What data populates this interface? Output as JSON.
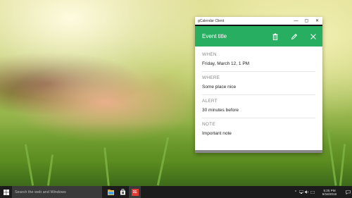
{
  "window": {
    "title": "gCalendar Client",
    "controls": {
      "minimize": "—",
      "maximize": "▢",
      "close": "✕"
    }
  },
  "header": {
    "event_title": "Event title",
    "accent_color": "#27ae60",
    "actions": [
      "trash-icon",
      "pencil-icon",
      "close-icon"
    ]
  },
  "fields": [
    {
      "label": "WHEN",
      "value": "Friday, March 12, 1 PM"
    },
    {
      "label": "WHERE",
      "value": "Some place nice"
    },
    {
      "label": "ALERT",
      "value": "30 minutes before"
    },
    {
      "label": "NOTE",
      "value": "Important note"
    }
  ],
  "taskbar": {
    "search_placeholder": "Search the web and Windows",
    "apps": [
      "file-explorer-icon",
      "store-icon",
      "calendar-app-icon"
    ],
    "calendar_badge": "31",
    "tray_icons": [
      "chevron-up-icon",
      "network-icon",
      "volume-icon",
      "keyboard-icon",
      "message-icon"
    ],
    "time": "5:25 PM",
    "date": "9/18/2016"
  }
}
